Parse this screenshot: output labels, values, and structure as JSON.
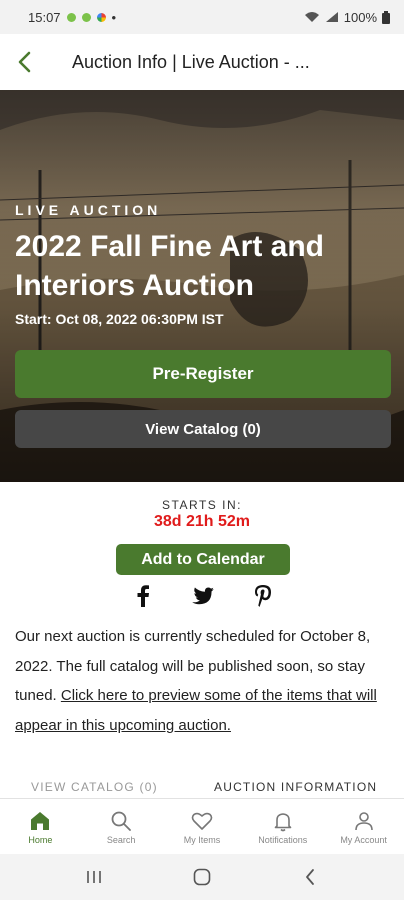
{
  "status_bar": {
    "time": "15:07",
    "dot": "•",
    "battery": "100%"
  },
  "header": {
    "title": "Auction Info | Live Auction - ..."
  },
  "hero": {
    "eyebrow": "LIVE AUCTION",
    "title": "2022 Fall Fine Art and Interiors Auction",
    "start": "Start: Oct 08, 2022 06:30PM IST",
    "preregister_label": "Pre-Register",
    "view_catalog_label": "View Catalog (0)"
  },
  "countdown": {
    "label": "STARTS IN:",
    "value": "38d 21h 52m"
  },
  "calendar_button": "Add to Calendar",
  "share": {
    "icons": [
      "facebook-icon",
      "twitter-icon",
      "pinterest-icon"
    ]
  },
  "description": {
    "text": "Our next auction is currently scheduled for October 8, 2022. The full catalog will be published soon, so stay tuned. ",
    "link": "Click here to preview some of the items that will appear in this upcoming auction."
  },
  "tabs": {
    "catalog": "VIEW CATALOG (0)",
    "info": "AUCTION INFORMATION"
  },
  "bottom_nav": {
    "home": "Home",
    "search": "Search",
    "my_items": "My Items",
    "notifications": "Notifications",
    "my_account": "My Account"
  },
  "colors": {
    "accent": "#4a7a2e",
    "countdown": "#e01b1b",
    "secondary_button": "#474747"
  }
}
